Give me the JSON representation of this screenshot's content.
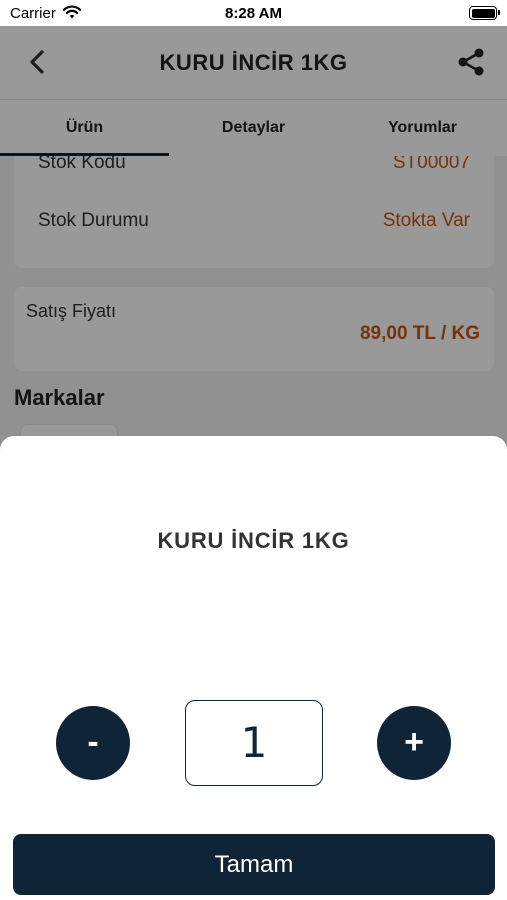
{
  "status_bar": {
    "carrier": "Carrier",
    "time": "8:28 AM",
    "icons": [
      "wifi-icon",
      "battery-icon"
    ]
  },
  "nav": {
    "title": "KURU İNCİR 1KG",
    "back_icon": "chevron-left-icon",
    "share_icon": "share-icon"
  },
  "tabs": [
    {
      "label": "Ürün",
      "active": true
    },
    {
      "label": "Detaylar",
      "active": false
    },
    {
      "label": "Yorumlar",
      "active": false
    }
  ],
  "stock_card": {
    "code_label": "Stok Kodu",
    "code_value": "ST00007",
    "status_label": "Stok Durumu",
    "status_value": "Stokta Var"
  },
  "price_card": {
    "label": "Satış Fiyatı",
    "value": "89,00 TL / KG"
  },
  "brands": {
    "title": "Markalar"
  },
  "sheet": {
    "title": "KURU İNCİR 1KG",
    "minus_label": "-",
    "plus_label": "+",
    "quantity": "1",
    "confirm_label": "Tamam"
  },
  "colors": {
    "primary": "#0f2436",
    "accent": "#c8520e",
    "background": "#f2f2f2"
  }
}
